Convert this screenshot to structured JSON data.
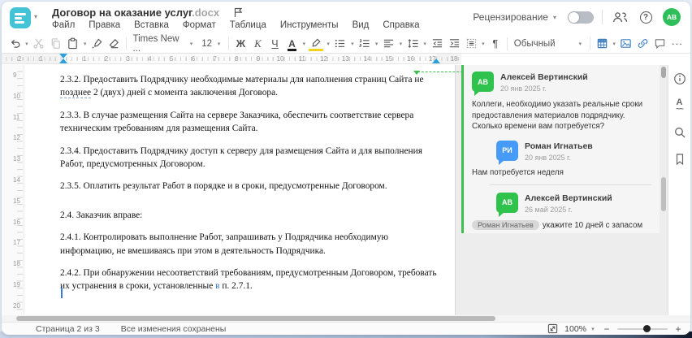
{
  "app": {
    "doc_title": "Договор на оказание услуг",
    "doc_ext": ".docx",
    "review_label": "Рецензирование",
    "avatar_initials": "АВ"
  },
  "menu": {
    "items": [
      "Файл",
      "Правка",
      "Вставка",
      "Формат",
      "Таблица",
      "Инструменты",
      "Вид",
      "Справка"
    ]
  },
  "toolbar": {
    "font_name": "Times New ...",
    "font_size": "12",
    "bold_label": "Ж",
    "italic_label": "К",
    "underline_label": "Ч",
    "font_color_letter": "А",
    "style_name": "Обычный",
    "pilcrow": "¶",
    "more_label": "..."
  },
  "icons": {
    "help_glyph": "?",
    "info_glyph": "i",
    "spellcheck_letter": "А",
    "spellcheck_wave": "~~",
    "caret": "▾"
  },
  "ruler": {
    "h_left": [
      "2",
      "1"
    ],
    "h_numbers": [
      "1",
      "2",
      "3",
      "4",
      "5",
      "6",
      "7",
      "8",
      "9",
      "10",
      "11",
      "12",
      "13",
      "14",
      "15",
      "16",
      "17",
      "18"
    ],
    "v_numbers": [
      "9",
      "10",
      "11",
      "12",
      "13",
      "14",
      "15",
      "16",
      "17",
      "18",
      "19",
      "20"
    ]
  },
  "document": {
    "p1_before": "2.3.2. Предоставить Подрядчику необходимые материалы для наполнения страниц Сайта не ",
    "p1_anchor": "позднее",
    "p1_after": " 2 (двух) дней с момента заключения Договора.",
    "p2": "2.3.3. В случае размещения Сайта на сервере Заказчика, обеспечить соответствие сервера техническим требованиям для размещения Сайта.",
    "p3": "2.3.4. Предоставить Подрядчику доступ к серверу для размещения Сайта и для выполнения Работ, предусмотренных Договором.",
    "p4": "2.3.5. Оплатить результат Работ в порядке и в сроки, предусмотренные Договором.",
    "p5": "2.4. Заказчик вправе:",
    "p6": "2.4.1. Контролировать выполнение Работ, запрашивать у Подрядчика необходимую информацию, не вмешиваясь при этом в деятельность Подрядчика.",
    "p7_before": "2.4.2. При обнаружении несоответствий требованиям, предусмотренным Договором, требовать их устранения в сроки, установленные ",
    "p7_link": "в",
    "p7_after": " п. 2.7.1."
  },
  "comments": {
    "thread": {
      "author1": "Алексей Вертинский",
      "initials1": "АВ",
      "date1": "20 янв 2025 г.",
      "text1": "Коллеги, необходимо указать реальные сроки предоставления материалов подрядчику. Сколько времени вам потребуется?",
      "reply_author": "Роман Игнатьев",
      "reply_initials": "РИ",
      "reply_date": "20 янв 2025 г.",
      "reply_text": "Нам потребуется неделя",
      "author2": "Алексей Вертинский",
      "initials2": "АВ",
      "date2": "26 май 2025 г.",
      "mention": "Роман Игнатьев",
      "text2": "укажите 10 дней с запасом"
    }
  },
  "status_bar": {
    "page_info": "Страница 2 из 3",
    "save_status": "Все изменения сохранены",
    "zoom_value": "100%",
    "zoom_minus": "−",
    "zoom_plus": "+"
  },
  "colors": {
    "accent_teal": "#42c3d6",
    "comment_green": "#2fc24c",
    "comment_blue": "#459bf7",
    "anchor_green": "#3fbe50",
    "marker_blue": "#2d9fdc"
  }
}
